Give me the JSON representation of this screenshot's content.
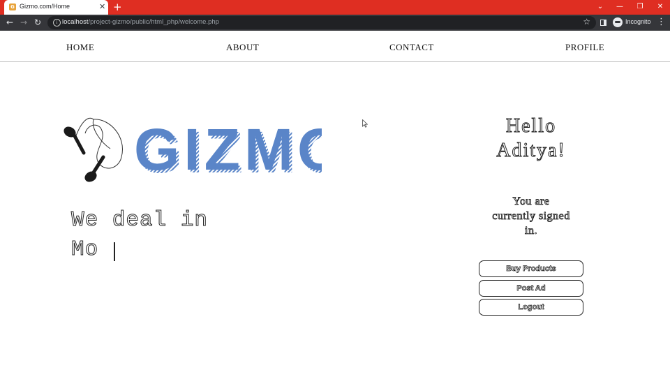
{
  "browser": {
    "tab_title": "Gizmo.com/Home",
    "tab_favicon": "gizmo-favicon",
    "url_host": "localhost",
    "url_path": "/project-gizmo/public/html_php/welcome.php",
    "profile_label": "Incognito",
    "colors": {
      "tabbar": "#df2e22",
      "toolbar": "#35363a",
      "omnibox": "#202124"
    }
  },
  "site": {
    "nav": [
      {
        "label": "HOME"
      },
      {
        "label": "ABOUT"
      },
      {
        "label": "CONTACT"
      },
      {
        "label": "PROFILE"
      }
    ],
    "logo": {
      "text": "GIZMO",
      "icon": "earphones-icon",
      "color": "#5a85c8"
    },
    "tagline": {
      "line1": "We deal in",
      "line2": "Mo"
    },
    "greeting": {
      "line1": "Hello",
      "line2": "Aditya!"
    },
    "status_text": {
      "line1": "You are",
      "line2": "currently signed",
      "line3": "in."
    },
    "buttons": [
      {
        "label": "Buy Products"
      },
      {
        "label": "Post Ad"
      },
      {
        "label": "Logout"
      }
    ]
  }
}
